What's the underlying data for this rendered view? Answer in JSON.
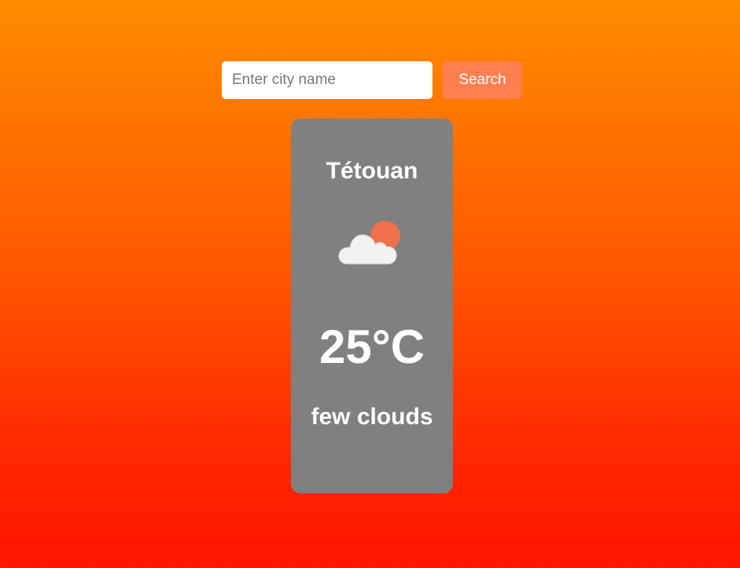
{
  "search": {
    "placeholder": "Enter city name",
    "value": "",
    "button_label": "Search"
  },
  "weather": {
    "city": "Tétouan",
    "icon": "few-clouds-icon",
    "temperature": "25°C",
    "description": "few clouds"
  },
  "colors": {
    "background_top": "#ff8c00",
    "background_bottom": "#ff1400",
    "search_button": "#ff7f50",
    "card": "#808080",
    "sun": "#f0714b",
    "cloud": "#f2f2f2"
  }
}
